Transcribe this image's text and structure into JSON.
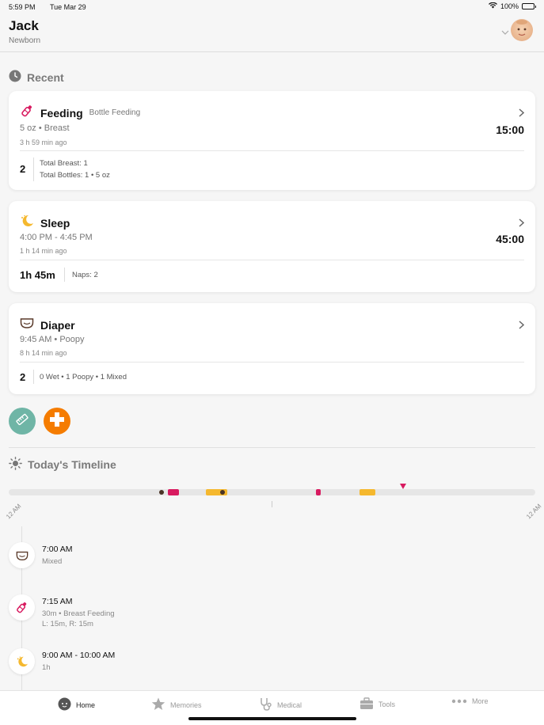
{
  "status_bar": {
    "time": "5:59 PM",
    "date": "Tue Mar 29",
    "battery": "100%"
  },
  "header": {
    "child_name": "Jack",
    "child_stage": "Newborn"
  },
  "recent": {
    "title": "Recent",
    "feeding": {
      "title": "Feeding",
      "subtitle": "Bottle Feeding",
      "detail": "5 oz • Breast",
      "ago": "3 h 59 min ago",
      "timer": "15:00",
      "stat_value": "2",
      "stat_line1": "Total Breast: 1",
      "stat_line2": "Total Bottles: 1 • 5 oz"
    },
    "sleep": {
      "title": "Sleep",
      "detail": "4:00 PM - 4:45 PM",
      "ago": "1 h 14 min ago",
      "timer": "45:00",
      "stat_value": "1h 45m",
      "stat_line1": "Naps: 2"
    },
    "diaper": {
      "title": "Diaper",
      "detail": "9:45 AM • Poopy",
      "ago": "8 h 14 min ago",
      "stat_value": "2",
      "stat_line1": "0 Wet • 1 Poopy • 1 Mixed"
    }
  },
  "timeline": {
    "title": "Today's Timeline",
    "start_label": "12 AM",
    "end_label": "12 AM",
    "entries": [
      {
        "time": "7:00 AM",
        "desc1": "Mixed",
        "desc2": "",
        "icon": "diaper-icon"
      },
      {
        "time": "7:15 AM",
        "desc1": "30m • Breast Feeding",
        "desc2": "L: 15m, R: 15m",
        "icon": "bottle-icon"
      },
      {
        "time": "9:00 AM - 10:00 AM",
        "desc1": "1h",
        "desc2": "",
        "icon": "sleep-icon"
      }
    ]
  },
  "tabs": [
    "Home",
    "Memories",
    "Medical",
    "Tools",
    "More"
  ],
  "colors": {
    "feeding": "#d81b60",
    "sleep": "#f5b82e",
    "diaper": "#5a3a2a",
    "growth": "#6fb5a6",
    "medical": "#f57c00",
    "poop_dot": "#4a3426"
  }
}
